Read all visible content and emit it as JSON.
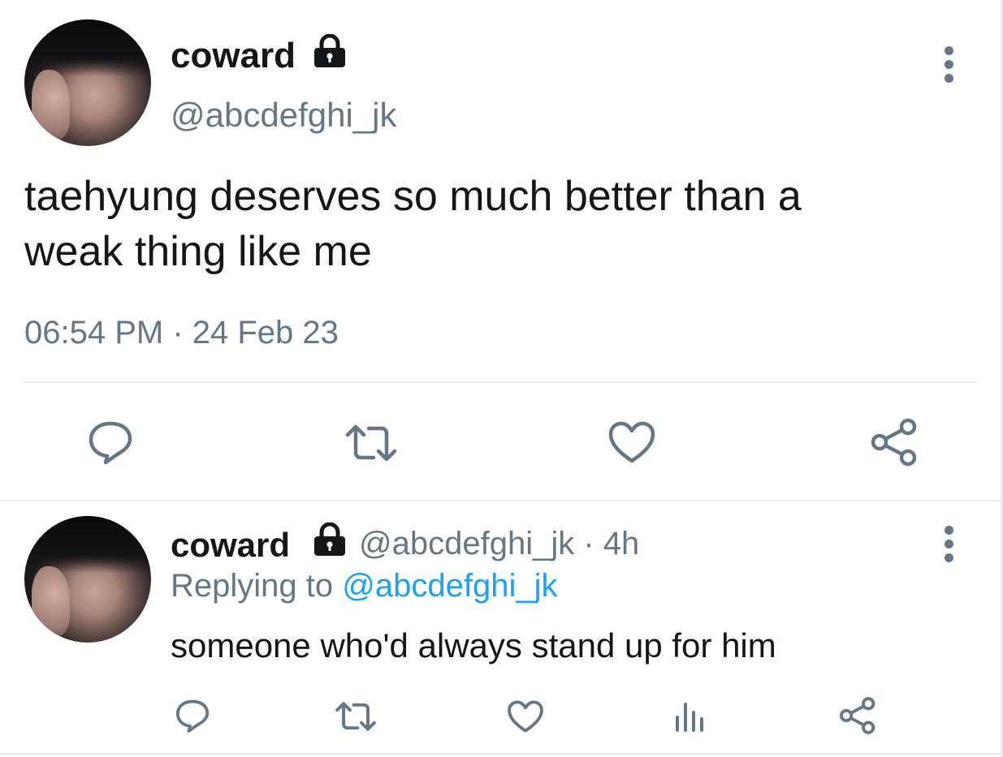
{
  "main_tweet": {
    "display_name": "coward",
    "handle": "@abcdefghi_jk",
    "text_line1": "taehyung deserves so much better than a",
    "text_line2": "weak thing like me",
    "timestamp": "06:54 PM · 24 Feb 23"
  },
  "reply_tweet": {
    "display_name": "coward",
    "handle_time": "@abcdefghi_jk · 4h",
    "replying_prefix": "Replying to",
    "replying_handle": "@abcdefghi_jk",
    "text": "someone who'd always stand up for him"
  },
  "icons": {
    "lock": "lock-icon",
    "more": "more-vertical-icon",
    "reply": "reply-icon",
    "retweet": "retweet-icon",
    "like": "heart-icon",
    "share": "share-icon",
    "analytics": "analytics-icon"
  },
  "colors": {
    "text": "#14171a",
    "secondary": "#657786",
    "link": "#1da1f2",
    "divider": "#e6ecf0"
  }
}
